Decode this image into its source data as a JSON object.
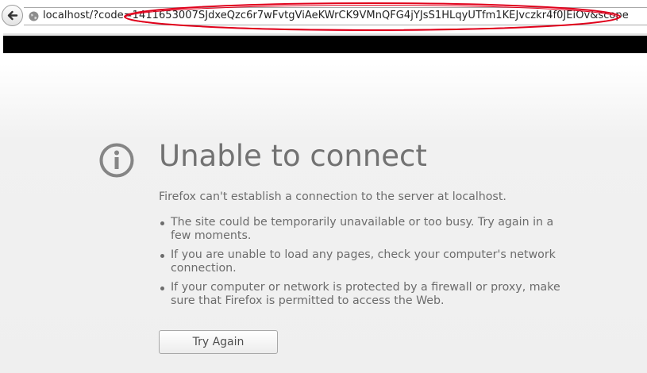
{
  "browser": {
    "url": "localhost/?code=1411653007SJdxeQzc6r7wFvtgViAeKWrCK9VMnQFG4jYJsS1HLqyUTfm1KEJvczkr4f0JEiOv&scope"
  },
  "error_page": {
    "title": "Unable to connect",
    "summary": "Firefox can't establish a connection to the server at localhost.",
    "bullets": [
      "The site could be temporarily unavailable or too busy. Try again in a few moments.",
      "If you are unable to load any pages, check your computer's network connection.",
      "If your computer or network is protected by a firewall or proxy, make sure that Firefox is permitted to access the Web."
    ],
    "try_again_label": "Try Again"
  },
  "icons": {
    "back": "back-arrow-icon",
    "site": "globe-icon",
    "info": "info-icon"
  },
  "colors": {
    "annotation": "#e0001b",
    "heading": "#727272",
    "body_text": "#6c6c6c",
    "redaction": "#000000"
  }
}
